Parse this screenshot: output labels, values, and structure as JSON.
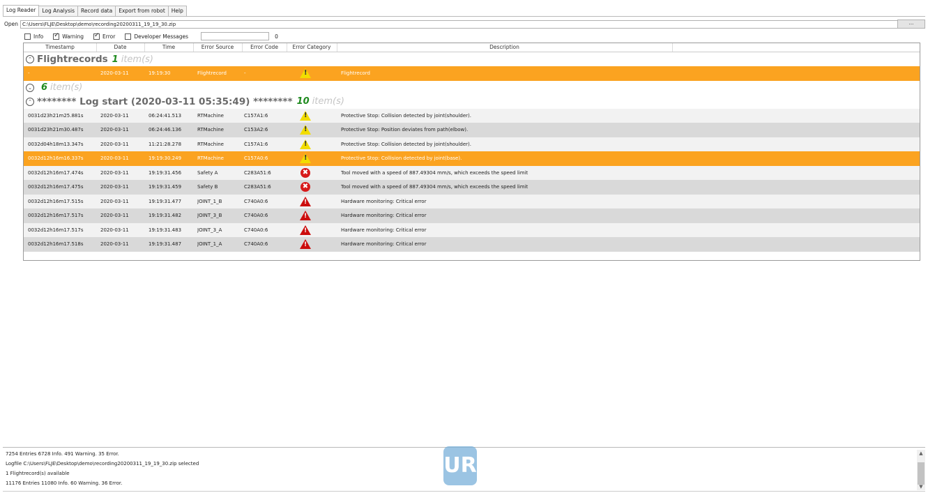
{
  "tabs": [
    "Log Reader",
    "Log Analysis",
    "Record data",
    "Export from robot",
    "Help"
  ],
  "open_row": {
    "label": "Open",
    "path": "C:\\Users\\FLJE\\Desktop\\demo\\recording20200311_19_19_30.zip",
    "browse": "..."
  },
  "filters": {
    "info": "Info",
    "warning": "Warning",
    "error": "Error",
    "developer": "Developer Messages",
    "info_checked": false,
    "warning_checked": true,
    "error_checked": true,
    "developer_checked": false,
    "count": "0"
  },
  "columns": [
    "Timestamp",
    "Date",
    "Time",
    "Error Source",
    "Error Code",
    "Error Category",
    "Description"
  ],
  "groups": {
    "flight": {
      "title": "Flightrecords",
      "count": "1",
      "items": "item(s)"
    },
    "empty": {
      "title": "",
      "count": "6",
      "items": "item(s)"
    },
    "log": {
      "title": "******** Log start (2020-03-11 05:35:49) ********",
      "count": "10",
      "items": "item(s)"
    }
  },
  "flight_rows": [
    {
      "ts": "-",
      "date": "2020-03-11",
      "time": "19:19:30",
      "src": "Flightrecord",
      "code": "-",
      "cat": "warning",
      "desc": "Flightrecord"
    }
  ],
  "log_rows": [
    {
      "ts": "0031d23h21m25.881s",
      "date": "2020-03-11",
      "time": "06:24:41.513",
      "src": "RTMachine",
      "code": "C157A1:6",
      "cat": "warning",
      "desc": "Protective Stop: Collision detected by joint(shoulder)."
    },
    {
      "ts": "0031d23h21m30.487s",
      "date": "2020-03-11",
      "time": "06:24:46.136",
      "src": "RTMachine",
      "code": "C153A2:6",
      "cat": "warning",
      "desc": "Protective Stop: Position deviates from path(elbow)."
    },
    {
      "ts": "0032d04h18m13.347s",
      "date": "2020-03-11",
      "time": "11:21:28.278",
      "src": "RTMachine",
      "code": "C157A1:6",
      "cat": "warning",
      "desc": "Protective Stop: Collision detected by joint(shoulder)."
    },
    {
      "ts": "0032d12h16m16.337s",
      "date": "2020-03-11",
      "time": "19:19:30.249",
      "src": "RTMachine",
      "code": "C157A0:6",
      "cat": "warning",
      "desc": "Protective Stop: Collision detected by joint(base)."
    },
    {
      "ts": "0032d12h16m17.474s",
      "date": "2020-03-11",
      "time": "19:19:31.456",
      "src": "Safety A",
      "code": "C283A51:6",
      "cat": "error",
      "desc": "Tool moved with a speed of 887.49304 mm/s, which exceeds the speed limit"
    },
    {
      "ts": "0032d12h16m17.475s",
      "date": "2020-03-11",
      "time": "19:19:31.459",
      "src": "Safety B",
      "code": "C283A51:6",
      "cat": "error",
      "desc": "Tool moved with a speed of 887.49304 mm/s, which exceeds the speed limit"
    },
    {
      "ts": "0032d12h16m17.515s",
      "date": "2020-03-11",
      "time": "19:19:31.477",
      "src": "JOINT_1_B",
      "code": "C740A0:6",
      "cat": "critical",
      "desc": "Hardware monitoring: Critical error"
    },
    {
      "ts": "0032d12h16m17.517s",
      "date": "2020-03-11",
      "time": "19:19:31.482",
      "src": "JOINT_3_B",
      "code": "C740A0:6",
      "cat": "critical",
      "desc": "Hardware monitoring: Critical error"
    },
    {
      "ts": "0032d12h16m17.517s",
      "date": "2020-03-11",
      "time": "19:19:31.483",
      "src": "JOINT_3_A",
      "code": "C740A0:6",
      "cat": "critical",
      "desc": "Hardware monitoring: Critical error"
    },
    {
      "ts": "0032d12h16m17.518s",
      "date": "2020-03-11",
      "time": "19:19:31.487",
      "src": "JOINT_1_A",
      "code": "C740A0:6",
      "cat": "critical",
      "desc": "Hardware monitoring: Critical error"
    }
  ],
  "status": {
    "line1": "7254 Entries 6728 Info. 491 Warning. 35 Error.",
    "line2": "Logfile C:\\Users\\FLJE\\Desktop\\demo\\recording20200311_19_19_30.zip selected",
    "line3": "1 Flightrecord(s) available",
    "line4": "11176 Entries 11080 Info. 60 Warning. 36 Error."
  },
  "logo": "UR",
  "colors": {
    "highlight": "#fba320",
    "count_green": "#1e8a1e",
    "warning_yellow": "#f2dd00",
    "error_red": "#d71a1a"
  }
}
